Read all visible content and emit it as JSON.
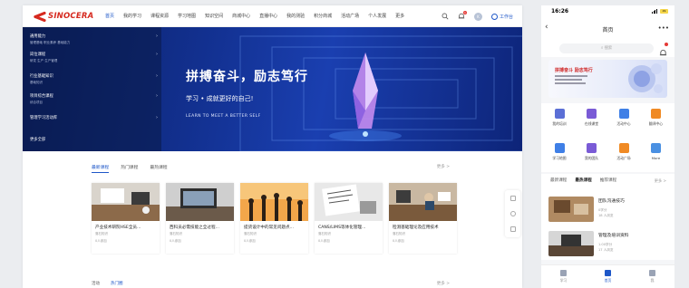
{
  "desktop": {
    "logo": {
      "text": "SINOCERA",
      "color": "#d6291f"
    },
    "nav": [
      {
        "label": "首页",
        "active": true
      },
      {
        "label": "我的学习"
      },
      {
        "label": "课程资源"
      },
      {
        "label": "学习地图"
      },
      {
        "label": "知识空间"
      },
      {
        "label": "商城中心"
      },
      {
        "label": "直播中心"
      },
      {
        "label": "我的测验"
      },
      {
        "label": "积分商城"
      },
      {
        "label": "活动广场"
      },
      {
        "label": "个人发展"
      },
      {
        "label": "更多"
      }
    ],
    "header_right": {
      "bell_count": "1",
      "avatar_letter": "K",
      "workbench_label": "工作台"
    },
    "side_menu": [
      {
        "title": "通用能力",
        "sub": "管理基础  职业素养  基础能力"
      },
      {
        "title": "岗位课程",
        "sub": "研发  生产  生产管理"
      },
      {
        "title": "行业基础知识",
        "sub": "基础知识"
      },
      {
        "title": "项目综合课程",
        "sub": "综合项目"
      },
      {
        "title": "管理学习活动库",
        "sub": ""
      },
      {
        "title": "更多全部",
        "sub": ""
      }
    ],
    "banner": {
      "title": "拼搏奋斗，励志笃行",
      "subtitle": "学习 • 成就更好的自己!",
      "english": "LEARN TO MEET A BETTER SELF",
      "bg_color": "#12308f"
    },
    "course_tabs": [
      {
        "label": "最新课程",
        "active": true
      },
      {
        "label": "热门课程"
      },
      {
        "label": "最热课程"
      }
    ],
    "more_label": "更多 >",
    "courses": [
      {
        "title": "产业技术研院HSE全员...",
        "meta": "落石知识",
        "count": "0人参加",
        "img": "office"
      },
      {
        "title": "西科员必需技能之全过程...",
        "meta": "落石知识",
        "count": "0人参加",
        "img": "laptop"
      },
      {
        "title": "提货设计中的常见问题点...",
        "meta": "落石知识",
        "count": "0人参加",
        "img": "team"
      },
      {
        "title": "CANS/LIMS等体化管理...",
        "meta": "落石知识",
        "count": "0人参加",
        "img": "notes"
      },
      {
        "title": "检测基础理论及应用技术",
        "meta": "落石知识",
        "count": "0人参加",
        "img": "meeting"
      }
    ],
    "bottom_section": {
      "tabs": [
        {
          "label": "活动"
        },
        {
          "label": "热门圈",
          "active": true
        }
      ],
      "more": "更多 >"
    }
  },
  "mobile": {
    "status_time": "16:26",
    "battery": "29",
    "title": "首页",
    "search_placeholder": "搜索",
    "banner_title": "拼搏奋斗 励志笃行",
    "grid": [
      {
        "label": "我的培训",
        "color": "#5b6fd6"
      },
      {
        "label": "在线课堂",
        "color": "#7a5bd6"
      },
      {
        "label": "活动中心",
        "color": "#3f7fe6"
      },
      {
        "label": "翻译中心",
        "color": "#f08a24"
      },
      {
        "label": "学习地图",
        "color": "#3f7fe6"
      },
      {
        "label": "我的团队",
        "color": "#7a5bd6"
      },
      {
        "label": "活动广场",
        "color": "#f08a24"
      },
      {
        "label": "More",
        "color": "#4a90e2"
      }
    ],
    "tabs": [
      {
        "label": "最新课程"
      },
      {
        "label": "最热课程",
        "active": true
      },
      {
        "label": "推荐课程"
      }
    ],
    "tabs_more": "更多 >",
    "courses": [
      {
        "title": "团队沟通技巧",
        "meta1": "0学分",
        "meta2": "18 人浏览"
      },
      {
        "title": "管理及培训资料",
        "meta1": "1.00学分",
        "meta2": "17 人浏览"
      }
    ],
    "tabbar": [
      {
        "label": "学习"
      },
      {
        "label": "首页",
        "active": true
      },
      {
        "label": "我"
      }
    ]
  }
}
